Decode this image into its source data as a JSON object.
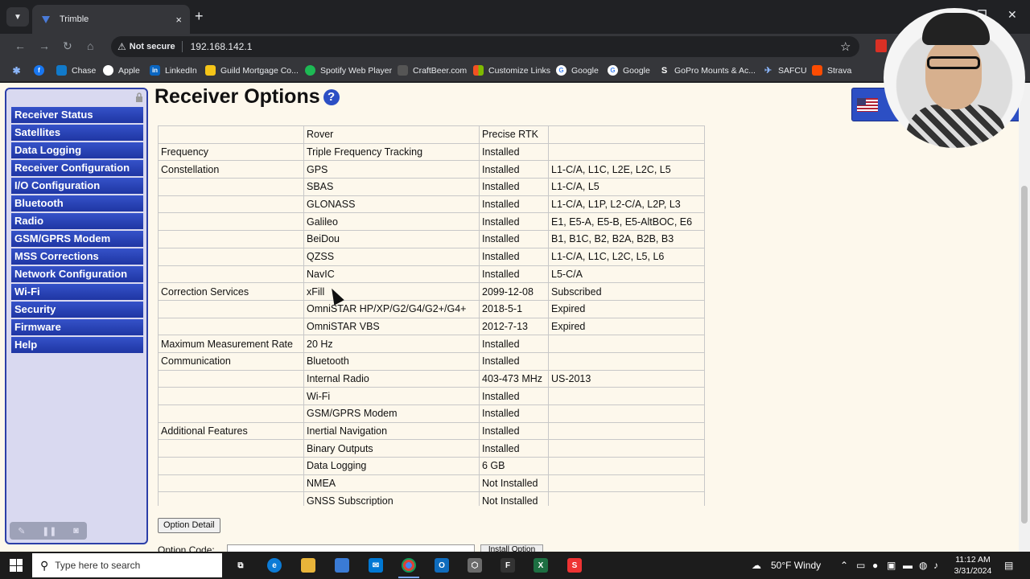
{
  "browser": {
    "tab_title": "Trimble",
    "tab_close": "×",
    "new_tab": "+",
    "not_secure": "Not secure",
    "url": "192.168.142.1",
    "bookmarks": [
      "Chase",
      "Apple",
      "LinkedIn",
      "Guild Mortgage Co...",
      "Spotify Web Player",
      "CraftBeer.com",
      "Customize Links",
      "Google",
      "Google",
      "GoPro Mounts & Ac...",
      "SAFCU",
      "Strava"
    ]
  },
  "sidebar": {
    "items": [
      "Receiver Status",
      "Satellites",
      "Data Logging",
      "Receiver Configuration",
      "I/O Configuration",
      "Bluetooth",
      "Radio",
      "GSM/GPRS Modem",
      "MSS Corrections",
      "Network Configuration",
      "Wi-Fi",
      "Security",
      "Firmware",
      "Help"
    ]
  },
  "main": {
    "title": "Receiver Options",
    "help": "?",
    "rows": [
      [
        "",
        "Rover",
        "Precise RTK",
        ""
      ],
      [
        "Frequency",
        "Triple Frequency Tracking",
        "Installed",
        ""
      ],
      [
        "Constellation",
        "GPS",
        "Installed",
        "L1-C/A, L1C, L2E, L2C, L5"
      ],
      [
        "",
        "SBAS",
        "Installed",
        "L1-C/A, L5"
      ],
      [
        "",
        "GLONASS",
        "Installed",
        "L1-C/A, L1P, L2-C/A, L2P, L3"
      ],
      [
        "",
        "Galileo",
        "Installed",
        "E1, E5-A, E5-B, E5-AltBOC, E6"
      ],
      [
        "",
        "BeiDou",
        "Installed",
        "B1, B1C, B2, B2A, B2B, B3"
      ],
      [
        "",
        "QZSS",
        "Installed",
        "L1-C/A, L1C, L2C, L5, L6"
      ],
      [
        "",
        "NavIC",
        "Installed",
        "L5-C/A"
      ],
      [
        "Correction Services",
        "xFill",
        "2099-12-08",
        "Subscribed"
      ],
      [
        "",
        "OmniSTAR HP/XP/G2/G4/G2+/G4+",
        "2018-5-1",
        "Expired"
      ],
      [
        "",
        "OmniSTAR VBS",
        "2012-7-13",
        "Expired"
      ],
      [
        "Maximum Measurement Rate",
        "20 Hz",
        "Installed",
        ""
      ],
      [
        "Communication",
        "Bluetooth",
        "Installed",
        ""
      ],
      [
        "",
        "Internal Radio",
        "403-473 MHz",
        "US-2013"
      ],
      [
        "",
        "Wi-Fi",
        "Installed",
        ""
      ],
      [
        "",
        "GSM/GPRS Modem",
        "Installed",
        ""
      ],
      [
        "Additional Features",
        "Inertial Navigation",
        "Installed",
        ""
      ],
      [
        "",
        "Binary Outputs",
        "Installed",
        ""
      ],
      [
        "",
        "Data Logging",
        "6 GB",
        ""
      ],
      [
        "",
        "NMEA",
        "Not Installed",
        ""
      ],
      [
        "",
        "GNSS Subscription",
        "Not Installed",
        ""
      ]
    ],
    "option_detail_button": "Option Detail",
    "option_code_label": "Option Code:",
    "install_option_button": "Install Option"
  },
  "taskbar": {
    "search_placeholder": "Type here to search",
    "weather": "50°F  Windy",
    "time": "11:12 AM",
    "date": "3/31/2024"
  }
}
